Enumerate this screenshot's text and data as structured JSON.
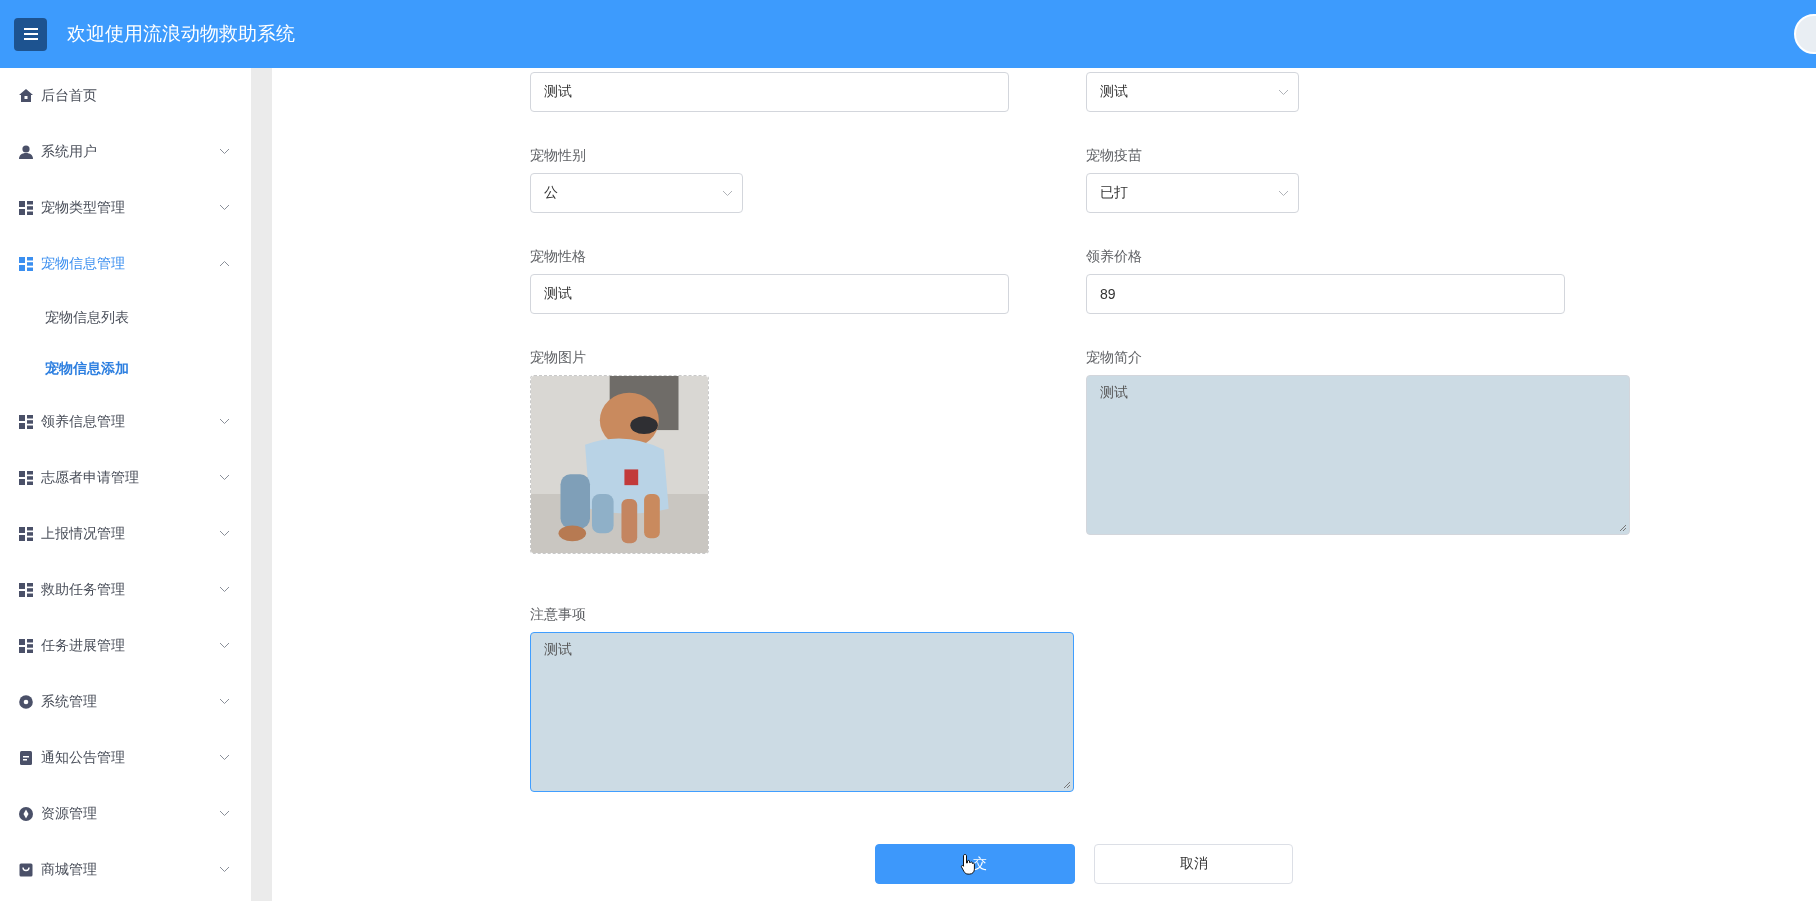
{
  "header": {
    "title": "欢迎使用流浪动物救助系统"
  },
  "sidebar": {
    "items": [
      {
        "label": "后台首页",
        "kind": "link",
        "selected": false
      },
      {
        "label": "系统用户",
        "kind": "menu",
        "expanded": false,
        "selected": false
      },
      {
        "label": "宠物类型管理",
        "kind": "menu",
        "expanded": false,
        "selected": false
      },
      {
        "label": "宠物信息管理",
        "kind": "menu",
        "expanded": true,
        "selected": true,
        "children": [
          {
            "label": "宠物信息列表",
            "selected": false
          },
          {
            "label": "宠物信息添加",
            "selected": true
          }
        ]
      },
      {
        "label": "领养信息管理",
        "kind": "menu",
        "expanded": false,
        "selected": false
      },
      {
        "label": "志愿者申请管理",
        "kind": "menu",
        "expanded": false,
        "selected": false
      },
      {
        "label": "上报情况管理",
        "kind": "menu",
        "expanded": false,
        "selected": false
      },
      {
        "label": "救助任务管理",
        "kind": "menu",
        "expanded": false,
        "selected": false
      },
      {
        "label": "任务进展管理",
        "kind": "menu",
        "expanded": false,
        "selected": false
      },
      {
        "label": "系统管理",
        "kind": "menu",
        "expanded": false,
        "selected": false
      },
      {
        "label": "通知公告管理",
        "kind": "menu",
        "expanded": false,
        "selected": false
      },
      {
        "label": "资源管理",
        "kind": "menu",
        "expanded": false,
        "selected": false
      },
      {
        "label": "商城管理",
        "kind": "menu",
        "expanded": false,
        "selected": false
      }
    ]
  },
  "form": {
    "fields": [
      {
        "kind": "input",
        "value": "测试"
      },
      {
        "kind": "select",
        "value": "测试"
      },
      {
        "label": "宠物性别",
        "kind": "select",
        "value": "公"
      },
      {
        "label": "宠物疫苗",
        "kind": "select",
        "value": "已打"
      },
      {
        "label": "宠物性格",
        "kind": "input",
        "value": "测试"
      },
      {
        "label": "领养价格",
        "kind": "input",
        "value": "89"
      },
      {
        "label": "宠物图片"
      },
      {
        "label": "宠物简介",
        "kind": "textarea",
        "value": "测试",
        "focused": false
      },
      {
        "label": "注意事项",
        "kind": "textarea",
        "value": "测试",
        "focused": true
      }
    ],
    "buttons": [
      {
        "label": "交",
        "kind": "primary"
      },
      {
        "label": "取消",
        "kind": "default"
      }
    ]
  }
}
